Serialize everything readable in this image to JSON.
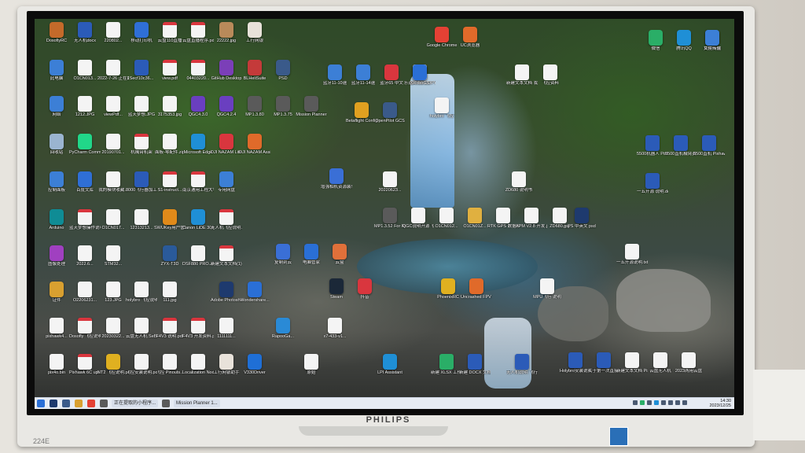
{
  "monitor": {
    "brand": "PHILIPS",
    "model": "224E"
  },
  "desktop_icons": [
    {
      "label": "DosofiyRC",
      "kind": "app",
      "color": "#c46a2a"
    },
    {
      "label": "无人机docx",
      "kind": "word",
      "color": "#2b5bb8"
    },
    {
      "label": "220802...",
      "kind": "doc",
      "color": "#f4f4f4"
    },
    {
      "label": "移动打印机",
      "kind": "app",
      "color": "#2f6fd6"
    },
    {
      "label": "云盘110直播",
      "kind": "pdf",
      "color": "#f4f4f4"
    },
    {
      "label": "云盘直播程序.pdf",
      "kind": "pdf",
      "color": "#f4f4f4"
    },
    {
      "label": "22222.jpg",
      "kind": "app",
      "color": "#b98a5a"
    },
    {
      "label": "工行网银",
      "kind": "app",
      "color": "#e8e2da"
    },
    {
      "label": "此电脑",
      "kind": "app",
      "color": "#3c7fd6"
    },
    {
      "label": "O1CN013...",
      "kind": "doc",
      "color": "#f4f4f4"
    },
    {
      "label": "2022-7-26 正在翻译...",
      "kind": "doc",
      "color": "#f4f4f4"
    },
    {
      "label": "Secf10c36...",
      "kind": "word",
      "color": "#2b5bb8"
    },
    {
      "label": "view.pdf",
      "kind": "pdf",
      "color": "#f4f4f4"
    },
    {
      "label": "04403220...",
      "kind": "pdf",
      "color": "#f4f4f4"
    },
    {
      "label": "GitHub Desktop",
      "kind": "app",
      "color": "#7b3fb8"
    },
    {
      "label": "BLHeliSuite",
      "kind": "app",
      "color": "#c43a3a"
    },
    {
      "label": "PSD",
      "kind": "app",
      "color": "#3a5a8a"
    },
    {
      "label": "网络",
      "kind": "app",
      "color": "#3c7fd6"
    },
    {
      "label": "1212.JPG",
      "kind": "doc",
      "color": "#f4f4f4"
    },
    {
      "label": "viewPdf...",
      "kind": "doc",
      "color": "#f4f4f4"
    },
    {
      "label": "蓝天梦想.JPG",
      "kind": "doc",
      "color": "#f4f4f4"
    },
    {
      "label": "3175353.jpg",
      "kind": "doc",
      "color": "#f4f4f4"
    },
    {
      "label": "QGC4.3.0",
      "kind": "app",
      "color": "#6a3fc0"
    },
    {
      "label": "QGC4.2.4",
      "kind": "app",
      "color": "#6a3fc0"
    },
    {
      "label": "MP1.3.80",
      "kind": "app",
      "color": "#5a5a5a"
    },
    {
      "label": "MP1.3.75",
      "kind": "app",
      "color": "#5a5a5a"
    },
    {
      "label": "Mission Planner",
      "kind": "app",
      "color": "#5a5a5a"
    },
    {
      "label": "回收站",
      "kind": "app",
      "color": "#9ab4d0"
    },
    {
      "label": "PyCharm Community...",
      "kind": "app",
      "color": "#21d789"
    },
    {
      "label": "20190701...",
      "kind": "doc",
      "color": "#f4f4f4"
    },
    {
      "label": "机械臂机架",
      "kind": "pdf",
      "color": "#f4f4f4"
    },
    {
      "label": "面板-零配件.zip",
      "kind": "doc",
      "color": "#f4f4f4"
    },
    {
      "label": "Microsoft Edge",
      "kind": "app",
      "color": "#1f8fd6"
    },
    {
      "label": "DJI NAZAM Lite Assist...",
      "kind": "app",
      "color": "#d9363e"
    },
    {
      "label": "DJI NAZAM Assistant...",
      "kind": "app",
      "color": "#e06a2a"
    },
    {
      "label": "控制面板",
      "kind": "app",
      "color": "#3c7fd6"
    },
    {
      "label": "百度文库",
      "kind": "app",
      "color": "#2f6fd6"
    },
    {
      "label": "我的模块收藏...",
      "kind": "doc",
      "color": "#f4f4f4"
    },
    {
      "label": "8000飞行器加工合同",
      "kind": "word",
      "color": "#2b5bb8"
    },
    {
      "label": "S1-instruct...",
      "kind": "pdf",
      "color": "#f4f4f4"
    },
    {
      "label": "南京通用工程大学.pdf",
      "kind": "pdf",
      "color": "#f4f4f4"
    },
    {
      "label": "专用网盘",
      "kind": "app",
      "color": "#3c7fd6"
    },
    {
      "label": "Arduino",
      "kind": "app",
      "color": "#0f8c95"
    },
    {
      "label": "蓝天梦想操作说明.pdf",
      "kind": "pdf",
      "color": "#f4f4f4"
    },
    {
      "label": "O1CN017...",
      "kind": "doc",
      "color": "#f4f4f4"
    },
    {
      "label": "12313213...",
      "kind": "doc",
      "color": "#f4f4f4"
    },
    {
      "label": "SWUKey用户管理工具",
      "kind": "app",
      "color": "#e08a1a"
    },
    {
      "label": "Canon LiDE 300 OnLine...",
      "kind": "app",
      "color": "#1f8fd6"
    },
    {
      "label": "无人机飞控说明.pdf",
      "kind": "pdf",
      "color": "#f4f4f4"
    },
    {
      "label": "图像处理",
      "kind": "app",
      "color": "#a040c0"
    },
    {
      "label": "2022.6...",
      "kind": "doc",
      "color": "#f4f4f4"
    },
    {
      "label": "STM32...",
      "kind": "doc",
      "color": "#f4f4f4"
    },
    {
      "label": "ZYX-T3D",
      "kind": "app",
      "color": "#2a5a9a"
    },
    {
      "label": "DSF880 PRO.JPG",
      "kind": "doc",
      "color": "#f4f4f4"
    },
    {
      "label": "新建文本文档(1).pdf",
      "kind": "pdf",
      "color": "#f4f4f4"
    },
    {
      "label": "证件",
      "kind": "app",
      "color": "#d9a030"
    },
    {
      "label": "O2206231...",
      "kind": "doc",
      "color": "#f4f4f4"
    },
    {
      "label": "123.JPG",
      "kind": "doc",
      "color": "#f4f4f4"
    },
    {
      "label": "holybro 飞控说明",
      "kind": "doc",
      "color": "#f4f4f4"
    },
    {
      "label": "111.jpg",
      "kind": "doc",
      "color": "#f4f4f4"
    },
    {
      "label": "Adobe Photoshop...",
      "kind": "app",
      "color": "#1e3a6e"
    },
    {
      "label": "Wondershare...",
      "kind": "app",
      "color": "#2a6fd6"
    },
    {
      "label": "pixhawk4...",
      "kind": "doc",
      "color": "#f4f4f4"
    },
    {
      "label": "Dosofly 飞控说明",
      "kind": "pdf",
      "color": "#f4f4f4"
    },
    {
      "label": "20230322...",
      "kind": "doc",
      "color": "#f4f4f4"
    },
    {
      "label": "云盘无人机 SeBase.pdf",
      "kind": "doc",
      "color": "#f4f4f4"
    },
    {
      "label": "F4V3 说明.pdf",
      "kind": "pdf",
      "color": "#f4f4f4"
    },
    {
      "label": "F4V3 开发资料.pdf",
      "kind": "pdf",
      "color": "#f4f4f4"
    },
    {
      "label": "1111111...",
      "kind": "doc",
      "color": "#f4f4f4"
    },
    {
      "label": "RapooGa...",
      "kind": "app",
      "color": "#2a8ad6"
    },
    {
      "label": "x7-433-v1...",
      "kind": "doc",
      "color": "#f4f4f4"
    },
    {
      "label": "pix4o.bin",
      "kind": "doc",
      "color": "#f4f4f4"
    },
    {
      "label": "Pixhawk 6C upright...",
      "kind": "pdf",
      "color": "#f4f4f4"
    },
    {
      "label": "NT2 飞控说明.pdf",
      "kind": "app",
      "color": "#e0b020"
    },
    {
      "label": "飞控安装说明.pdf",
      "kind": "doc",
      "color": "#f4f4f4"
    },
    {
      "label": "飞控 Pinouts...",
      "kind": "doc",
      "color": "#f4f4f4"
    },
    {
      "label": "Localization Nodes...",
      "kind": "doc",
      "color": "#f4f4f4"
    },
    {
      "label": "工行网银助手",
      "kind": "app",
      "color": "#e8e2da"
    },
    {
      "label": "V330Driver",
      "kind": "app",
      "color": "#1f6fd6"
    },
    {
      "label": "原始",
      "kind": "doc",
      "color": "#f4f4f4"
    },
    {
      "label": "Google Chrome",
      "kind": "app",
      "color": "#e44134"
    },
    {
      "label": "UC浏览器",
      "kind": "app",
      "color": "#e06a2a"
    },
    {
      "label": "微信",
      "kind": "app",
      "color": "#2aae67"
    },
    {
      "label": "腾讯QQ",
      "kind": "app",
      "color": "#1f8fd6"
    },
    {
      "label": "百度网盘",
      "kind": "app",
      "color": "#1f6fd6"
    },
    {
      "label": "文件传输",
      "kind": "app",
      "color": "#3c7fd6"
    },
    {
      "label": "Betaflight Configura...",
      "kind": "app",
      "color": "#e0a020"
    },
    {
      "label": "OpenPilot GCS",
      "kind": "app",
      "color": "#3a5a8a"
    },
    {
      "label": "蓝牙11-10速",
      "kind": "app",
      "color": "#3c7fd6"
    },
    {
      "label": "蓝牙11-14速",
      "kind": "app",
      "color": "#3c7fd6"
    },
    {
      "label": "蓝牙65 中文",
      "kind": "app",
      "color": "#d9363e"
    },
    {
      "label": "乐迪AT9S COPY",
      "kind": "doc",
      "color": "#f4f4f4"
    },
    {
      "label": "XRoboGS",
      "kind": "app",
      "color": "#2a6fd6"
    },
    {
      "label": "holybro 飞控",
      "kind": "doc",
      "color": "#f4f4f4"
    },
    {
      "label": "新建文本文档 我的",
      "kind": "doc",
      "color": "#f4f4f4"
    },
    {
      "label": "飞控资料",
      "kind": "doc",
      "color": "#f4f4f4"
    },
    {
      "label": "5500机器人 Pixhawk",
      "kind": "word",
      "color": "#2b5bb8"
    },
    {
      "label": "5500直机械臂资料",
      "kind": "word",
      "color": "#2b5bb8"
    },
    {
      "label": "5500直机 Pixhawk4...",
      "kind": "word",
      "color": "#2b5bb8"
    },
    {
      "label": "增强相机资源装软件",
      "kind": "app",
      "color": "#3a6fd6"
    },
    {
      "label": "20220623...",
      "kind": "doc",
      "color": "#f4f4f4"
    },
    {
      "label": "ZD680 说明书",
      "kind": "doc",
      "color": "#f4f4f4"
    },
    {
      "label": "一五开源 说明.docx",
      "kind": "word",
      "color": "#2b5bb8"
    },
    {
      "label": "MP1.3.52 For Ra...",
      "kind": "app",
      "color": "#5a5a5a"
    },
    {
      "label": "QGC说明开源飞行.jpg",
      "kind": "doc",
      "color": "#f4f4f4"
    },
    {
      "label": "O1CN012...",
      "kind": "doc",
      "color": "#f4f4f4"
    },
    {
      "label": "O1CN01Z...",
      "kind": "doc",
      "color": "#e0b040"
    },
    {
      "label": "RTK GPS 数据测试",
      "kind": "doc",
      "color": "#f4f4f4"
    },
    {
      "label": "APM V2.8 开发.jpg",
      "kind": "doc",
      "color": "#f4f4f4"
    },
    {
      "label": "ZD680.jpg",
      "kind": "doc",
      "color": "#f4f4f4"
    },
    {
      "label": "PS 中英文 psd",
      "kind": "app",
      "color": "#1e3a6e"
    },
    {
      "label": "一五开源说明.txt",
      "kind": "doc",
      "color": "#f4f4f4"
    },
    {
      "label": "复制到云",
      "kind": "app",
      "color": "#3a6fd6"
    },
    {
      "label": "电脑管家",
      "kind": "app",
      "color": "#2a6fd6"
    },
    {
      "label": "云盒",
      "kind": "app",
      "color": "#e0703a"
    },
    {
      "label": "Steam",
      "kind": "app",
      "color": "#1b2838"
    },
    {
      "label": "抖音",
      "kind": "app",
      "color": "#d9363e"
    },
    {
      "label": "PhoenixRC",
      "kind": "app",
      "color": "#e0b020"
    },
    {
      "label": "Uncrashed FPV Drone...",
      "kind": "app",
      "color": "#e06a2a"
    },
    {
      "label": "MPU飞行 说明",
      "kind": "doc",
      "color": "#f4f4f4"
    },
    {
      "label": "Holybro安装说明(合集)",
      "kind": "word",
      "color": "#2b5bb8"
    },
    {
      "label": "关于第一次直接用无人机...",
      "kind": "word",
      "color": "#2b5bb8"
    },
    {
      "label": "新建文本文档 Pixhawk...",
      "kind": "doc",
      "color": "#f4f4f4"
    },
    {
      "label": "云盘无人机",
      "kind": "doc",
      "color": "#f4f4f4"
    },
    {
      "label": "2023两用云盘",
      "kind": "doc",
      "color": "#f4f4f4"
    },
    {
      "label": "LPI Assistant",
      "kind": "app",
      "color": "#1f8fd6"
    },
    {
      "label": "新建 XLSX 工作表",
      "kind": "doc",
      "color": "#2aae67"
    },
    {
      "label": "新建 DOCX 文档",
      "kind": "word",
      "color": "#2b5bb8"
    },
    {
      "label": "无人机说明 飞行说明",
      "kind": "word",
      "color": "#2b5bb8"
    }
  ],
  "taskbar": {
    "start_icon": "windows-start-icon",
    "items": [
      {
        "label": "正在提取的小程序...",
        "icon": "app-icon"
      },
      {
        "label": "Mission Planner 1...",
        "icon": "mission-planner-icon"
      }
    ],
    "time": "14:30",
    "date": "2023/12/25"
  }
}
